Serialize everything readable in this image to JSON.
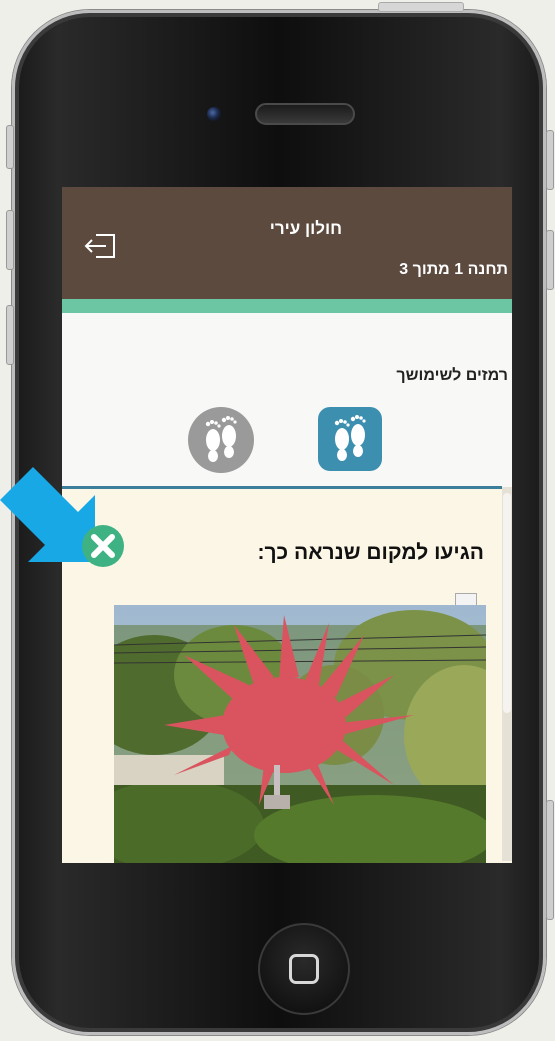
{
  "header": {
    "title": "חולון עירי",
    "subtitle": "תחנה 1 מתוך 3",
    "exit_icon": "exit-icon"
  },
  "hints": {
    "label": "רמזים לשימושך",
    "items": [
      {
        "icon": "footprints-icon",
        "state": "active"
      },
      {
        "icon": "footprints-icon",
        "state": "disabled"
      }
    ]
  },
  "question": {
    "text": "הגיעו למקום שנראה כך:"
  },
  "colors": {
    "header_bg": "#5c4a3f",
    "accent_green": "#6cc6a4",
    "accent_blue": "#3d8fb0",
    "content_bg": "#fcf6e6",
    "close_green": "#3fb283",
    "arrow_cyan": "#18a8e6"
  }
}
